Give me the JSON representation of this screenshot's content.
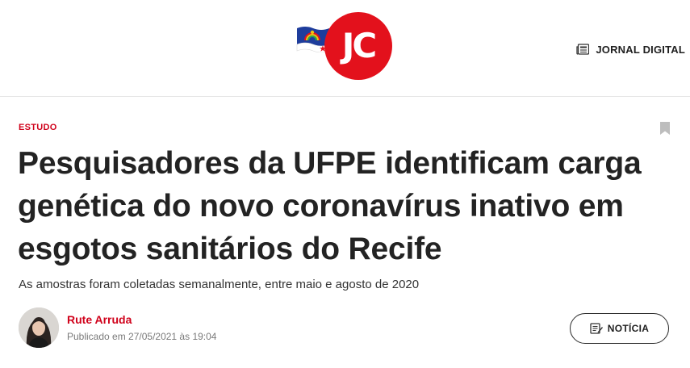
{
  "header": {
    "logo_text": "JC",
    "jornal_digital_label": "JORNAL DIGITAL"
  },
  "article": {
    "tag": "ESTUDO",
    "title": "Pesquisadores da UFPE identificam carga genética do novo coronavírus inativo em esgotos sanitários do Recife",
    "subtitle": "As amostras foram coletadas semanalmente, entre maio e agosto de 2020",
    "author_name": "Rute Arruda",
    "published": "Publicado em 27/05/2021 às 19:04",
    "type_badge": "NOTÍCIA"
  },
  "colors": {
    "brand_red": "#e3111c",
    "accent_red": "#d0021b",
    "text_dark": "#232323"
  },
  "icons": {
    "jornal": "newspaper-icon",
    "bookmark": "bookmark-icon",
    "badge": "article-icon"
  }
}
